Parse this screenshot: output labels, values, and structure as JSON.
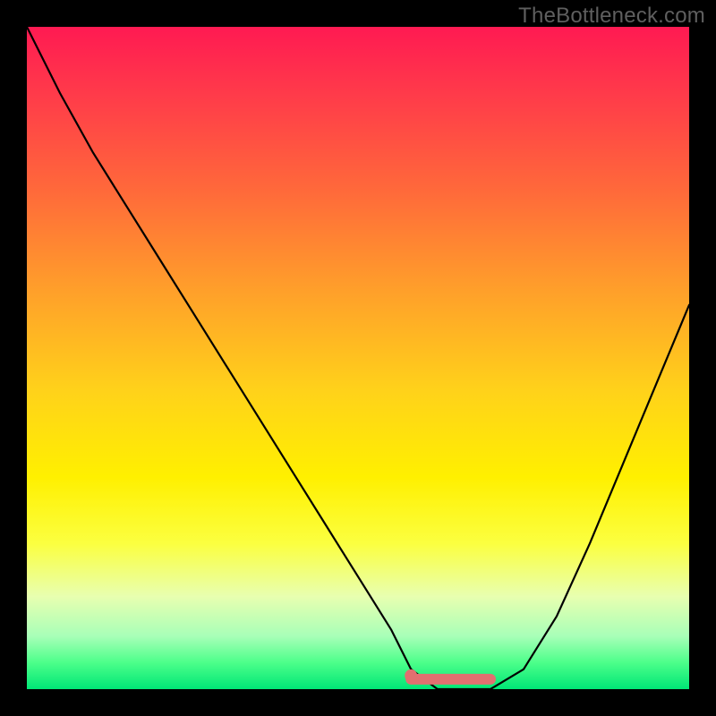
{
  "watermark": "TheBottleneck.com",
  "chart_data": {
    "type": "line",
    "title": "",
    "xlabel": "",
    "ylabel": "",
    "xlim": [
      0,
      100
    ],
    "ylim": [
      0,
      100
    ],
    "series": [
      {
        "name": "bottleneck-curve",
        "x": [
          0,
          5,
          10,
          15,
          20,
          25,
          30,
          35,
          40,
          45,
          50,
          55,
          58,
          62,
          66,
          70,
          75,
          80,
          85,
          90,
          95,
          100
        ],
        "y": [
          100,
          90,
          81,
          73,
          65,
          57,
          49,
          41,
          33,
          25,
          17,
          9,
          3,
          0,
          0,
          0,
          3,
          11,
          22,
          34,
          46,
          58
        ]
      }
    ],
    "highlight_band": {
      "x_start": 58,
      "x_end": 70,
      "y": 1.5
    },
    "gradient_stops": [
      {
        "pos": 0,
        "color": "#ff1a52"
      },
      {
        "pos": 10,
        "color": "#ff3a4a"
      },
      {
        "pos": 25,
        "color": "#ff6a3a"
      },
      {
        "pos": 40,
        "color": "#ffa02a"
      },
      {
        "pos": 55,
        "color": "#ffd21a"
      },
      {
        "pos": 68,
        "color": "#fff000"
      },
      {
        "pos": 78,
        "color": "#fbff40"
      },
      {
        "pos": 86,
        "color": "#e8ffb0"
      },
      {
        "pos": 92,
        "color": "#a8ffb8"
      },
      {
        "pos": 96,
        "color": "#4cff8a"
      },
      {
        "pos": 100,
        "color": "#00e676"
      }
    ],
    "colors": {
      "curve": "#000000",
      "highlight": "#e17070",
      "frame": "#000000"
    }
  }
}
